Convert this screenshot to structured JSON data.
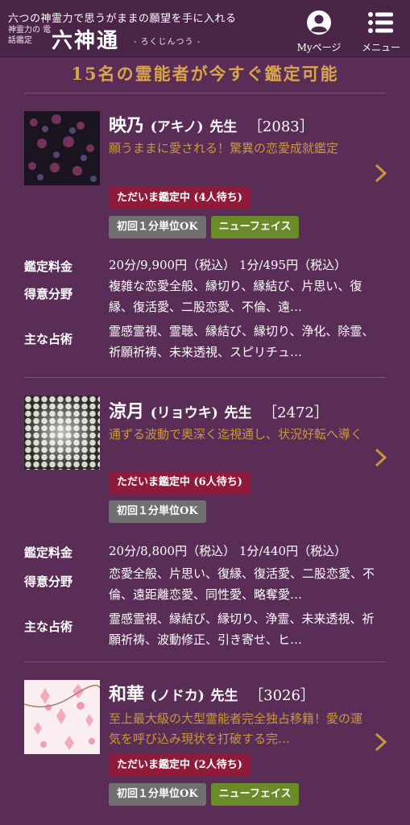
{
  "header": {
    "tagline": "六つの神霊力で思うがままの願望を手に入れる",
    "subtag": "神霊力の 電話鑑定",
    "logo": "六神通",
    "logo_sub": "- ろくじんつう -",
    "mypage_label": "Myページ",
    "menu_label": "メニュー"
  },
  "available_text": "15名の霊能者が今すぐ鑑定可能",
  "labels": {
    "fee": "鑑定料金",
    "specialty": "得意分野",
    "method": "主な占術"
  },
  "colors": {
    "background": "#5a2d56",
    "gold": "#c9983e",
    "status": "#8e1b3a",
    "grey_tag": "#707070",
    "green_tag": "#6b8a2a"
  },
  "counselors": [
    {
      "name": "映乃",
      "kana": "(アキノ)",
      "title": "先生",
      "code": "［2083］",
      "catch": "願うままに愛される！驚異の恋愛成就鑑定",
      "status": "ただいま鑑定中 (4人待ち)",
      "tag1": "初回１分単位OK",
      "tag2": "ニューフェイス",
      "fee": "20分/9,900円（税込） 1分/495円（税込）",
      "specialty": "複雑な恋愛全般、縁切り、縁結び、片思い、復縁、復活愛、二股恋愛、不倫、遠…",
      "method": "霊感霊視、霊聴、縁結び、縁切り、浄化、除霊、祈願祈祷、未来透視、スピリチュ…"
    },
    {
      "name": "涼月",
      "kana": "(リョウキ)",
      "title": "先生",
      "code": "［2472］",
      "catch": "通ずる波動で奥深く迄視通し、状況好転へ導く",
      "status": "ただいま鑑定中 (6人待ち)",
      "tag1": "初回１分単位OK",
      "fee": "20分/8,800円（税込） 1分/440円（税込）",
      "specialty": "恋愛全般、片思い、復縁、復活愛、二股恋愛、不倫、遠距離恋愛、同性愛、略奪愛…",
      "method": "霊感霊視、縁結び、縁切り、浄霊、未来透視、祈願祈祷、波動修正、引き寄せ、ヒ…"
    },
    {
      "name": "和華",
      "kana": "(ノドカ)",
      "title": "先生",
      "code": "［3026］",
      "catch": "至上最大級の大型霊能者完全独占移籍！愛の運気を呼び込み現状を打破する完…",
      "status": "ただいま鑑定中 (2人待ち)",
      "tag1": "初回１分単位OK",
      "tag2": "ニューフェイス"
    }
  ]
}
